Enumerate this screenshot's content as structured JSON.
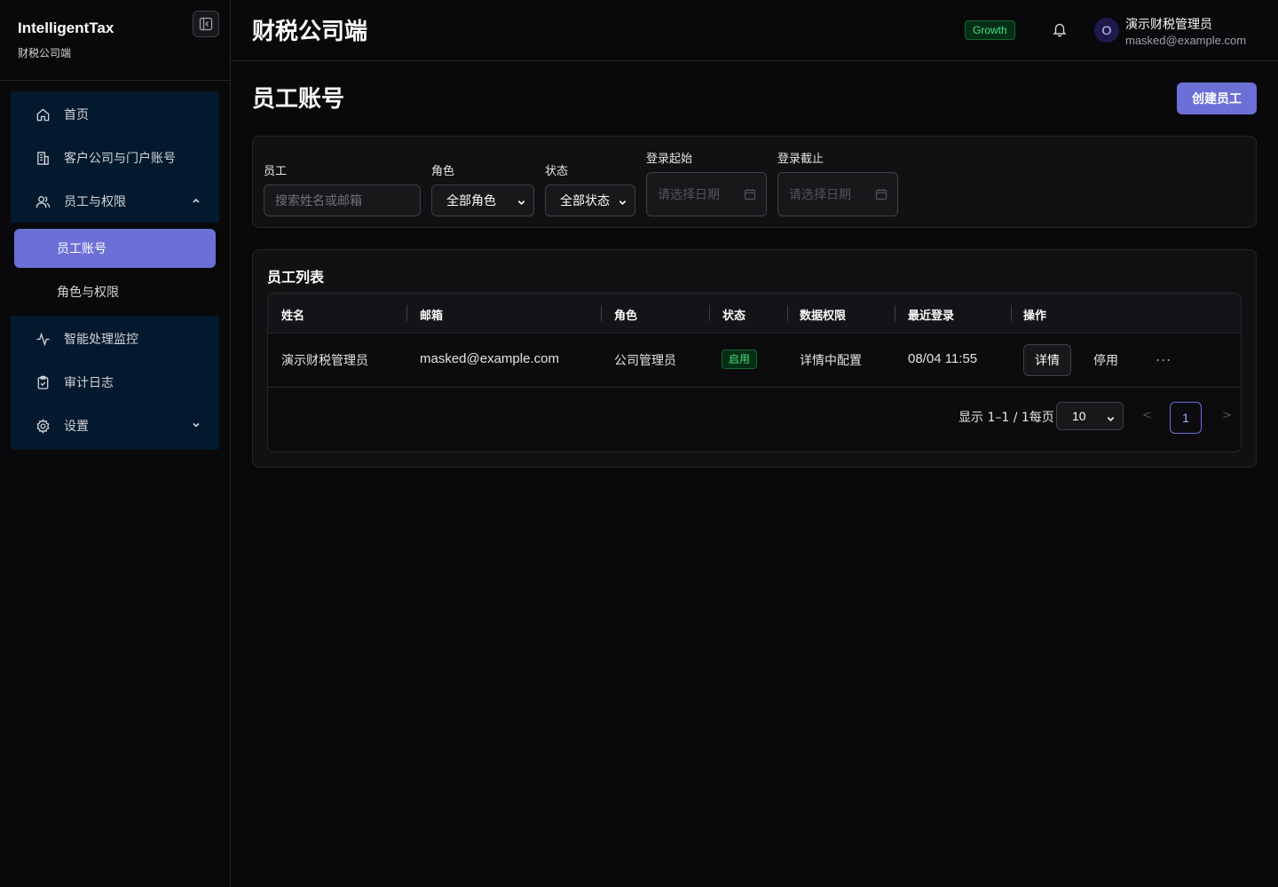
{
  "brand": {
    "title": "IntelligentTax",
    "subtitle": "财税公司端"
  },
  "header": {
    "app_title": "财税公司端",
    "plan_badge": "Growth",
    "user": {
      "avatar_initial": "O",
      "name": "演示财税管理员",
      "email": "masked@example.com"
    }
  },
  "sidebar": {
    "items": [
      {
        "label": "首页",
        "icon": "home-icon"
      },
      {
        "label": "客户公司与门户账号",
        "icon": "building-icon"
      },
      {
        "label": "员工与权限",
        "icon": "users-icon",
        "expanded": true
      },
      {
        "label": "智能处理监控",
        "icon": "activity-icon"
      },
      {
        "label": "审计日志",
        "icon": "clipboard-icon"
      },
      {
        "label": "设置",
        "icon": "gear-icon",
        "expanded": false
      }
    ],
    "subitems": [
      {
        "label": "员工账号",
        "active": true
      },
      {
        "label": "角色与权限",
        "active": false
      }
    ]
  },
  "page": {
    "title": "员工账号",
    "create_button": "创建员工"
  },
  "filters": {
    "employee_label": "员工",
    "employee_placeholder": "搜索姓名或邮箱",
    "role_label": "角色",
    "role_value": "全部角色",
    "status_label": "状态",
    "status_value": "全部状态",
    "login_start_label": "登录起始",
    "login_start_placeholder": "请选择日期",
    "login_end_label": "登录截止",
    "login_end_placeholder": "请选择日期"
  },
  "list": {
    "title": "员工列表",
    "columns": [
      "姓名",
      "邮箱",
      "角色",
      "状态",
      "数据权限",
      "最近登录",
      "操作"
    ],
    "rows": [
      {
        "name": "演示财税管理员",
        "email": "masked@example.com",
        "role": "公司管理员",
        "status": "启用",
        "data_scope": "详情中配置",
        "last_login": "08/04 11:55",
        "action_detail": "详情",
        "action_disable": "停用",
        "action_more": "..."
      }
    ],
    "pagination": {
      "info": "显示 1–1 / 1每页",
      "page_size": "10",
      "prev": "<",
      "current_page": "1",
      "next": ">"
    }
  },
  "colors": {
    "accent": "#6b6fd6",
    "success": "#4ade80",
    "nav_bg": "#031a2e",
    "background": "#09090b"
  }
}
